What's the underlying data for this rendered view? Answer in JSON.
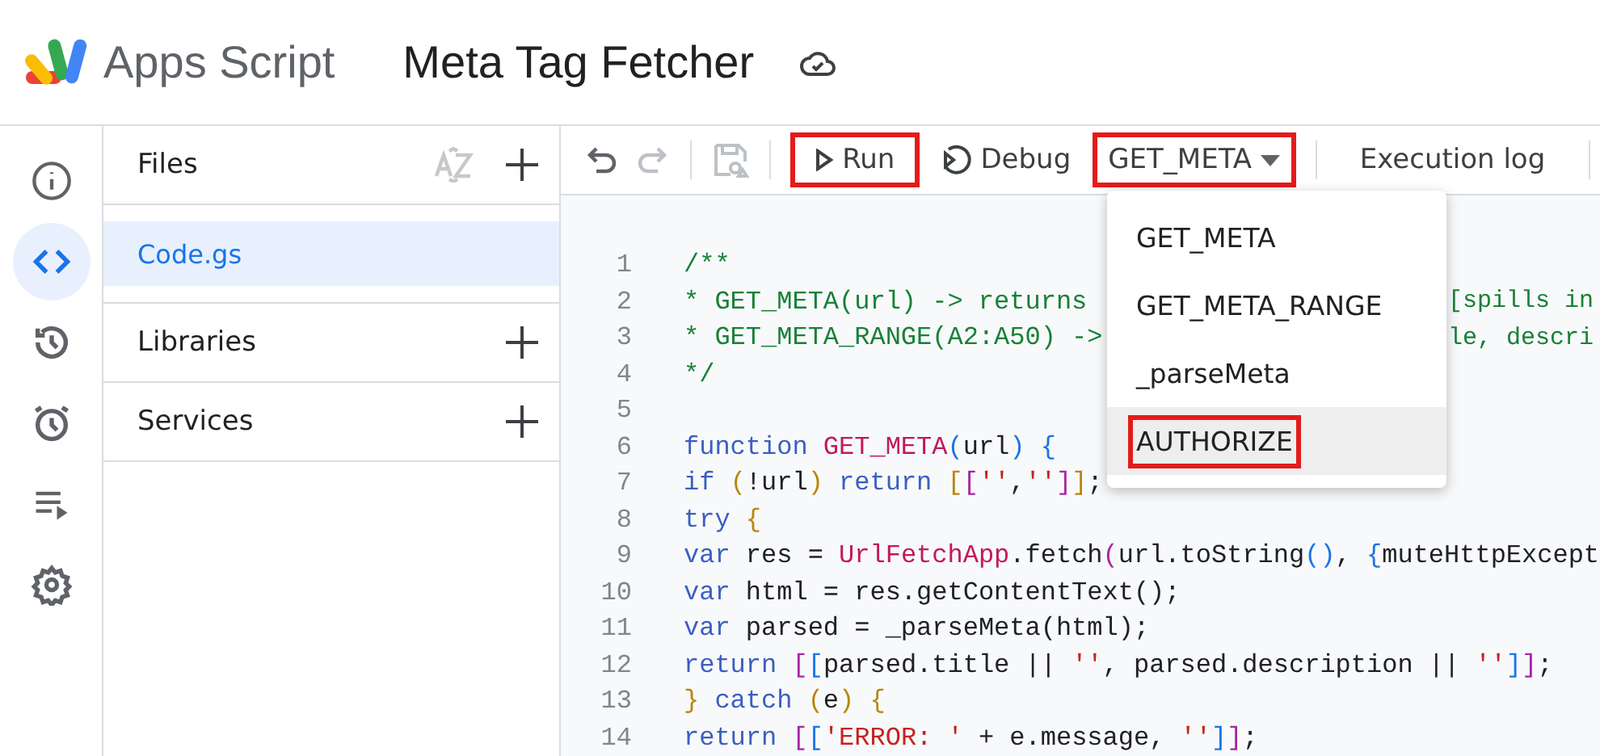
{
  "header": {
    "app_name": "Apps Script",
    "project_title": "Meta Tag Fetcher"
  },
  "rail": [
    {
      "selected": false
    },
    {
      "selected": true
    },
    {
      "selected": false
    },
    {
      "selected": false
    },
    {
      "selected": false
    },
    {
      "selected": false
    }
  ],
  "panel": {
    "files_title": "Files",
    "files": [
      {
        "name": "Code.gs",
        "selected": true
      }
    ],
    "sections": [
      {
        "title": "Libraries"
      },
      {
        "title": "Services"
      }
    ]
  },
  "toolbar": {
    "undo_disabled": false,
    "redo_disabled": true,
    "save_disabled": true,
    "run": {
      "label": "Run",
      "highlighted": true
    },
    "debug": {
      "label": "Debug",
      "highlighted": false
    },
    "function_select": {
      "value": "GET_META",
      "highlighted": true
    },
    "execution_log": {
      "label": "Execution log",
      "highlighted": false
    }
  },
  "function_menu": [
    {
      "label": "GET_META",
      "selected": false,
      "highlighted": false
    },
    {
      "label": "GET_META_RANGE",
      "selected": false,
      "highlighted": false
    },
    {
      "label": "_parseMeta",
      "selected": false,
      "highlighted": false
    },
    {
      "label": "AUTHORIZE",
      "selected": true,
      "highlighted": true
    }
  ],
  "code_lines": [
    {
      "number": "1",
      "tokens": [
        {
          "text": "/**",
          "kind": "comment"
        }
      ]
    },
    {
      "number": "2",
      "tokens": [
        {
          "text": "* GET_META(url) -> returns",
          "kind": "comment"
        }
      ],
      "after_menu": [
        {
          "text": "[spills in",
          "kind": "comment"
        }
      ]
    },
    {
      "number": "3",
      "tokens": [
        {
          "text": "* GET_META_RANGE(A2:A50) ->",
          "kind": "comment"
        }
      ],
      "after_menu": [
        {
          "text": "le, descri",
          "kind": "comment"
        }
      ]
    },
    {
      "number": "4",
      "tokens": [
        {
          "text": "*/",
          "kind": "comment"
        }
      ]
    },
    {
      "number": "5"
    },
    {
      "number": "6",
      "tokens": [
        {
          "text": "function ",
          "kind": "keyword"
        },
        {
          "text": "GET_META",
          "kind": "function"
        },
        {
          "text": "(",
          "kind": "bracket3"
        },
        {
          "text": "url",
          "kind": "plain"
        },
        {
          "text": ") {",
          "kind": "bracket3"
        }
      ]
    },
    {
      "number": "7",
      "tokens": [
        {
          "text": "if ",
          "kind": "keyword"
        },
        {
          "text": "(",
          "kind": "bracket1"
        },
        {
          "text": "!url",
          "kind": "plain"
        },
        {
          "text": ") ",
          "kind": "bracket1"
        },
        {
          "text": "return ",
          "kind": "keyword"
        },
        {
          "text": "[",
          "kind": "bracket1"
        },
        {
          "text": "[",
          "kind": "bracket2"
        },
        {
          "text": "''",
          "kind": "string"
        },
        {
          "text": ",",
          "kind": "plain"
        },
        {
          "text": "''",
          "kind": "string"
        },
        {
          "text": "]",
          "kind": "bracket2"
        },
        {
          "text": "]",
          "kind": "bracket1"
        },
        {
          "text": ";",
          "kind": "plain"
        }
      ]
    },
    {
      "number": "8",
      "tokens": [
        {
          "text": "try ",
          "kind": "keyword"
        },
        {
          "text": "{",
          "kind": "bracket1"
        }
      ]
    },
    {
      "number": "9",
      "tokens": [
        {
          "text": "var",
          "kind": "keyword"
        },
        {
          "text": " res = ",
          "kind": "plain"
        },
        {
          "text": "UrlFetchApp",
          "kind": "function"
        },
        {
          "text": ".fetch",
          "kind": "plain"
        },
        {
          "text": "(",
          "kind": "bracket2"
        },
        {
          "text": "url.toString",
          "kind": "plain"
        },
        {
          "text": "()",
          "kind": "bracket3"
        },
        {
          "text": ", ",
          "kind": "plain"
        },
        {
          "text": "{",
          "kind": "bracket3"
        },
        {
          "text": "muteHttpExcept",
          "kind": "plain"
        }
      ]
    },
    {
      "number": "10",
      "tokens": [
        {
          "text": "var",
          "kind": "keyword"
        },
        {
          "text": " html = res.getContentText();",
          "kind": "plain"
        }
      ]
    },
    {
      "number": "11",
      "tokens": [
        {
          "text": "var",
          "kind": "keyword"
        },
        {
          "text": " parsed = _parseMeta(html);",
          "kind": "plain"
        }
      ]
    },
    {
      "number": "12",
      "tokens": [
        {
          "text": "return ",
          "kind": "keyword"
        },
        {
          "text": "[",
          "kind": "bracket2"
        },
        {
          "text": "[",
          "kind": "bracket3"
        },
        {
          "text": "parsed.title || ",
          "kind": "plain"
        },
        {
          "text": "''",
          "kind": "string"
        },
        {
          "text": ", parsed.description || ",
          "kind": "plain"
        },
        {
          "text": "''",
          "kind": "string"
        },
        {
          "text": "]",
          "kind": "bracket3"
        },
        {
          "text": "]",
          "kind": "bracket2"
        },
        {
          "text": ";",
          "kind": "plain"
        }
      ]
    },
    {
      "number": "13",
      "tokens": [
        {
          "text": "} ",
          "kind": "bracket1"
        },
        {
          "text": "catch ",
          "kind": "keyword"
        },
        {
          "text": "(",
          "kind": "bracket1"
        },
        {
          "text": "e",
          "kind": "plain"
        },
        {
          "text": ") {",
          "kind": "bracket1"
        }
      ]
    },
    {
      "number": "14",
      "tokens": [
        {
          "text": "return ",
          "kind": "keyword"
        },
        {
          "text": "[",
          "kind": "bracket2"
        },
        {
          "text": "[",
          "kind": "bracket3"
        },
        {
          "text": "'ERROR: '",
          "kind": "string"
        },
        {
          "text": " + e.message, ",
          "kind": "plain"
        },
        {
          "text": "''",
          "kind": "string"
        },
        {
          "text": "]",
          "kind": "bracket3"
        },
        {
          "text": "]",
          "kind": "bracket2"
        },
        {
          "text": ";",
          "kind": "plain"
        }
      ]
    }
  ]
}
